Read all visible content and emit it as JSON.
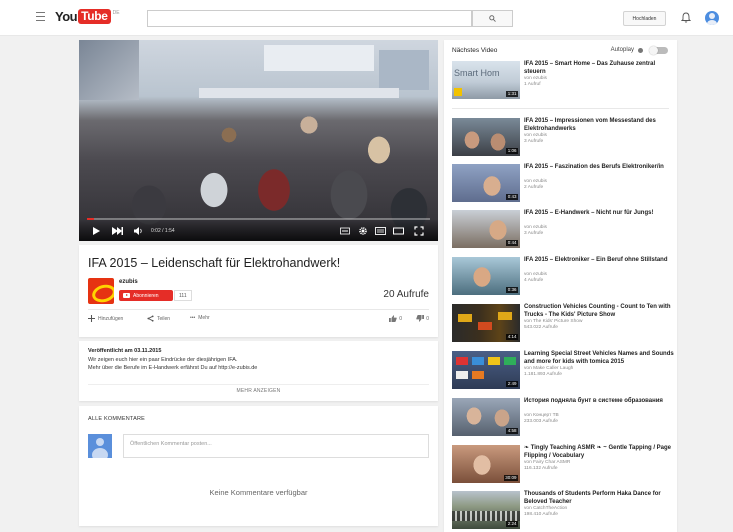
{
  "masthead": {
    "logo_you": "You",
    "logo_tube": "Tube",
    "region": "DE",
    "search_placeholder": "",
    "upload_label": "Hochladen"
  },
  "player": {
    "time": "0:02 / 1:54",
    "progress_fraction": 0.02
  },
  "video": {
    "title": "IFA 2015 – Leidenschaft für Elektrohandwerk!",
    "channel": "ezubis",
    "subscribe_label": "Abonnieren",
    "subscriber_count": "111",
    "views": "20 Aufrufe",
    "action_add": "Hinzufügen",
    "action_share": "Teilen",
    "action_more": "Mehr",
    "likes": "0",
    "dislikes": "0"
  },
  "description": {
    "published": "Veröffentlicht am 03.11.2015",
    "line1": "Wir zeigen euch hier ein paar Eindrücke der diesjährigen IFA.",
    "line2": "Mehr über die Berufe im E-Handwerk erfährst Du auf http://e-zubis.de",
    "show_more": "MEHR ANZEIGEN"
  },
  "comments": {
    "heading": "ALLE KOMMENTARE",
    "input_placeholder": "Öffentlichen Kommentar posten...",
    "empty_text": "Keine Kommentare verfügbar"
  },
  "sidebar": {
    "heading": "Nächstes Video",
    "autoplay_label": "Autoplay",
    "videos": [
      {
        "title": "IFA 2015 – Smart Home – Das Zuhause zentral steuern",
        "channel": "von ezubis",
        "views": "1 Aufruf",
        "duration": "1:31",
        "thumb_text": "Smart Hom"
      },
      {
        "title": "IFA 2015 – Impressionen vom Messestand des Elektrohandwerks",
        "channel": "von ezubis",
        "views": "3 Aufrufe",
        "duration": "1:06"
      },
      {
        "title": "IFA 2015 – Faszination des Berufs Elektroniker/in",
        "channel": "von ezubis",
        "views": "2 Aufrufe",
        "duration": "0:43"
      },
      {
        "title": "IFA 2015 – E-Handwerk – Nicht nur für Jungs!",
        "channel": "von ezubis",
        "views": "3 Aufrufe",
        "duration": "0:44"
      },
      {
        "title": "IFA 2015 – Elektroniker – Ein Beruf ohne Stillstand",
        "channel": "von ezubis",
        "views": "4 Aufrufe",
        "duration": "0:36"
      },
      {
        "title": "Construction Vehicles Counting - Count to Ten with Trucks - The Kids' Picture Show",
        "channel": "von The Kids' Picture Show",
        "views": "543.022 Aufrufe",
        "duration": "4:14"
      },
      {
        "title": "Learning Special Street Vehicles Names and Sounds and more for kids with tomica 2015",
        "channel": "von Make Caller Laugh",
        "views": "1.181.893 Aufrufe",
        "duration": "2:49"
      },
      {
        "title": "История подняла бунт в системе образования",
        "channel": "von Концерт ТВ",
        "views": "233.003 Aufrufe",
        "duration": "4:58"
      },
      {
        "title": "❧ Tingly Teaching ASMR ❧ ~ Gentle Tapping / Page Flipping / Vocabulary",
        "channel": "von Fairy Char ASMR",
        "views": "116.132 Aufrufe",
        "duration": "30:09"
      },
      {
        "title": "Thousands of Students Perform Haka Dance for Beloved Teacher",
        "channel": "von CatchTheAction",
        "views": "198.410 Aufrufe",
        "duration": "2:24"
      }
    ]
  }
}
